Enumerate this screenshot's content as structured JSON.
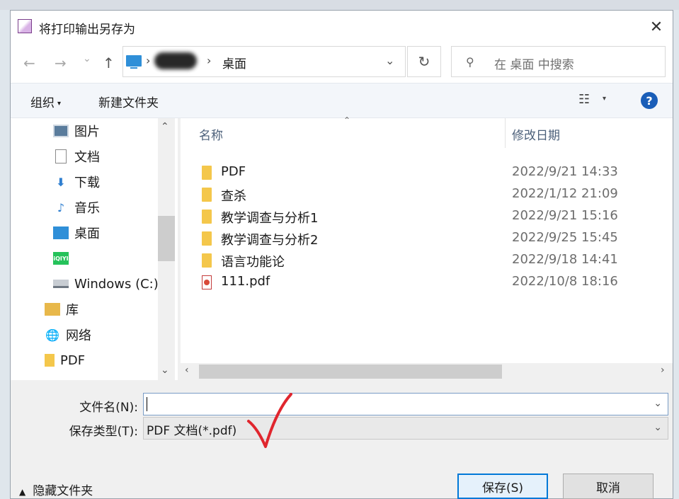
{
  "window": {
    "title": "将打印输出另存为",
    "close_glyph": "✕"
  },
  "address": {
    "back_glyph": "←",
    "forward_glyph": "→",
    "recent_glyph": "⌄",
    "up_glyph": "↑",
    "separator": "›",
    "current": "桌面",
    "dropdown_glyph": "⌄",
    "refresh_glyph": "↻"
  },
  "search": {
    "icon_glyph": "⚲",
    "placeholder": "在 桌面 中搜索"
  },
  "toolbar": {
    "organize_label": "组织",
    "organize_arrow": "▾",
    "new_folder_label": "新建文件夹",
    "view_glyph": "☷",
    "view_arrow": "▾",
    "help_glyph": "?"
  },
  "nav": {
    "items": [
      {
        "label": "图片",
        "icon": "pictures-icon"
      },
      {
        "label": "文档",
        "icon": "documents-icon"
      },
      {
        "label": "下载",
        "icon": "downloads-icon",
        "glyph": "⬇"
      },
      {
        "label": "音乐",
        "icon": "music-icon",
        "glyph": "♪"
      },
      {
        "label": "桌面",
        "icon": "desktop-icon"
      },
      {
        "label": "",
        "icon": "iqiyi-icon",
        "glyph": "iQIYI"
      },
      {
        "label": "Windows (C:)",
        "icon": "drive-icon"
      },
      {
        "label": "库",
        "icon": "library-icon"
      },
      {
        "label": "网络",
        "icon": "network-icon",
        "glyph": "🌐"
      },
      {
        "label": "PDF",
        "icon": "folder-icon"
      }
    ],
    "scroll_up": "⌃",
    "scroll_down": "⌄"
  },
  "files": {
    "sort_glyph": "⌃",
    "columns": [
      "名称",
      "修改日期"
    ],
    "rows": [
      {
        "name": "PDF",
        "date": "2022/9/21 14:33",
        "type": "folder"
      },
      {
        "name": "查杀",
        "date": "2022/1/12 21:09",
        "type": "folder"
      },
      {
        "name": "教学调查与分析1",
        "date": "2022/9/21 15:16",
        "type": "folder"
      },
      {
        "name": "教学调查与分析2",
        "date": "2022/9/25 15:45",
        "type": "folder"
      },
      {
        "name": "语言功能论",
        "date": "2022/9/18 14:41",
        "type": "folder"
      },
      {
        "name": "111.pdf",
        "date": "2022/10/8 18:16",
        "type": "pdf"
      }
    ],
    "hscroll_left": "‹",
    "hscroll_right": "›"
  },
  "form": {
    "filename_label": "文件名(N):",
    "filename_value": "",
    "filetype_label": "保存类型(T):",
    "filetype_value": "PDF 文档(*.pdf)",
    "dropdown_glyph": "⌄"
  },
  "footer": {
    "hide_folders_arrow": "▲",
    "hide_folders_label": "隐藏文件夹",
    "save_label": "保存(S)",
    "cancel_label": "取消"
  },
  "colors": {
    "accent": "#0078d7",
    "annotation_mark": "#e0262e"
  }
}
